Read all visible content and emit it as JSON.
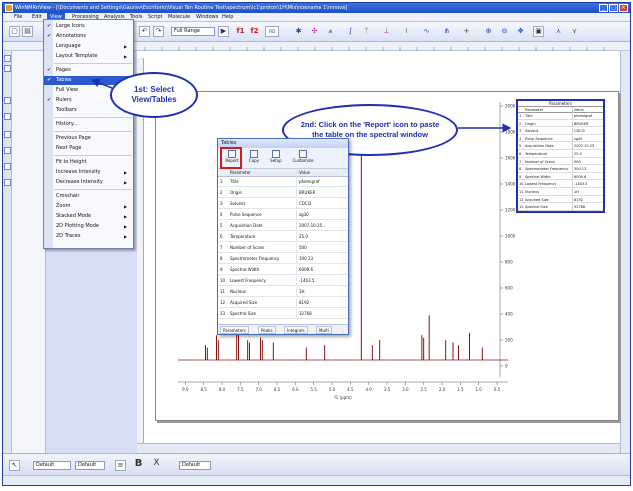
{
  "window": {
    "title": "WinNMRnView - [\\Documents and Settings\\Gaurav\\Escritorio\\Visual Ten Routine Test\\spectrum\\lc1\\proton\\1H\\Mix\\noename 1\\mnova]",
    "controls": [
      "_",
      "□",
      "×"
    ]
  },
  "menubar": {
    "items": [
      "File",
      "Edit",
      "View",
      "Processing",
      "Analysis",
      "Tools",
      "Script",
      "Molecule",
      "Windows",
      "Help"
    ],
    "active_index": 2
  },
  "toolbar": {
    "zoom_value": "Full Range",
    "label_fid": "FID",
    "label_f1": "f1",
    "label_f2": "f2"
  },
  "view_menu": {
    "items": [
      {
        "label": "Large Icons",
        "check": true
      },
      {
        "label": "Annotations",
        "check": true
      },
      {
        "label": "Language",
        "arrow": true
      },
      {
        "label": "Layout Template",
        "arrow": true
      },
      {
        "label": "Pages",
        "check": true
      },
      {
        "label": "Tables",
        "check": true,
        "highlight": true
      },
      {
        "label": "Full View"
      },
      {
        "label": "Rulers",
        "check": true
      },
      {
        "label": "Toolbars",
        "arrow": true
      },
      {
        "label": "History..."
      },
      {
        "label": "Previous Page"
      },
      {
        "label": "Next Page"
      },
      {
        "label": "Fit to Height"
      },
      {
        "label": "Increase Intensity",
        "arrow": true
      },
      {
        "label": "Decrease Intensity",
        "arrow": true
      },
      {
        "label": "Crosshair"
      },
      {
        "label": "Zoom",
        "arrow": true
      },
      {
        "label": "Stacked Mode",
        "arrow": true
      },
      {
        "label": "2D Plotting Mode",
        "arrow": true
      },
      {
        "label": "2D Traces",
        "arrow": true
      }
    ]
  },
  "callouts": {
    "first": "1st: Select View/Tables",
    "second": "2nd: Click on the 'Report' icon to paste the table on the spectral window"
  },
  "tables_window": {
    "title": "Tables",
    "tools": [
      "Report",
      "Copy",
      "Setup",
      "Customize"
    ],
    "header": {
      "param": "Parameter",
      "value": "Value"
    },
    "rows": [
      {
        "n": "1",
        "param": "Title",
        "value": "pfolmigraf"
      },
      {
        "n": "2",
        "param": "Origin",
        "value": "BRUKER"
      },
      {
        "n": "3",
        "param": "Solvent",
        "value": "CDCl3"
      },
      {
        "n": "4",
        "param": "Pulse Sequence",
        "value": "zg30"
      },
      {
        "n": "5",
        "param": "Acquisition Date",
        "value": "2007-10-25..."
      },
      {
        "n": "6",
        "param": "Temperature",
        "value": "25.0"
      },
      {
        "n": "7",
        "param": "Number of Scans",
        "value": "500"
      },
      {
        "n": "8",
        "param": "Spectrometer Frequency",
        "value": "300.13"
      },
      {
        "n": "9",
        "param": "Spectral Width",
        "value": "6009.6"
      },
      {
        "n": "10",
        "param": "Lowest Frequency",
        "value": "-1403.5"
      },
      {
        "n": "11",
        "param": "Nucleus",
        "value": "1H"
      },
      {
        "n": "12",
        "param": "Acquired Size",
        "value": "8192"
      },
      {
        "n": "13",
        "param": "Spectral Size",
        "value": "32768"
      }
    ],
    "tabs": [
      "Parameters",
      "Peaks",
      "Integrals",
      "Multi"
    ]
  },
  "pasted_table": {
    "title": "Parameters",
    "col_param": "Parameter",
    "col_value": "Value",
    "rows": [
      {
        "n": "1",
        "param": "Title",
        "value": "pfolmigraf"
      },
      {
        "n": "2",
        "param": "Origin",
        "value": "BRUKER"
      },
      {
        "n": "3",
        "param": "Solvent",
        "value": "CDCl3"
      },
      {
        "n": "4",
        "param": "Pulse Sequence",
        "value": "zg30"
      },
      {
        "n": "5",
        "param": "Acquisition Date",
        "value": "2007-10-25"
      },
      {
        "n": "6",
        "param": "Temperature",
        "value": "25.0"
      },
      {
        "n": "7",
        "param": "Number of Scans",
        "value": "500"
      },
      {
        "n": "8",
        "param": "Spectrometer Frequency",
        "value": "300.13"
      },
      {
        "n": "9",
        "param": "Spectral Width",
        "value": "6009.6"
      },
      {
        "n": "10",
        "param": "Lowest Frequency",
        "value": "-1403.5"
      },
      {
        "n": "11",
        "param": "Nucleus",
        "value": "1H"
      },
      {
        "n": "12",
        "param": "Acquired Size",
        "value": "8192"
      },
      {
        "n": "13",
        "param": "Spectral Size",
        "value": "32768"
      }
    ]
  },
  "spectrum": {
    "xlabel": "f1 (ppm)",
    "x_ticks": [
      "9.0",
      "8.5",
      "8.0",
      "7.5",
      "7.0",
      "6.5",
      "6.0",
      "5.5",
      "5.0",
      "4.5",
      "4.0",
      "3.5",
      "3.0",
      "2.5",
      "2.0",
      "1.5",
      "1.0",
      "0.5"
    ],
    "y_ticks": [
      "2000",
      "1800",
      "1600",
      "1400",
      "1200",
      "1000",
      "800",
      "600",
      "400",
      "200",
      "0"
    ],
    "line_color": "#8b1010",
    "peaks": [
      {
        "ppm": 8.45,
        "h": 0.06
      },
      {
        "ppm": 8.4,
        "h": 0.05
      },
      {
        "ppm": 8.15,
        "h": 0.1
      },
      {
        "ppm": 8.1,
        "h": 0.08
      },
      {
        "ppm": 7.6,
        "h": 0.11
      },
      {
        "ppm": 7.55,
        "h": 0.1
      },
      {
        "ppm": 7.3,
        "h": 0.08
      },
      {
        "ppm": 7.25,
        "h": 0.07
      },
      {
        "ppm": 6.95,
        "h": 0.09
      },
      {
        "ppm": 6.9,
        "h": 0.08
      },
      {
        "ppm": 6.6,
        "h": 0.07
      },
      {
        "ppm": 5.7,
        "h": 0.05
      },
      {
        "ppm": 5.2,
        "h": 0.06
      },
      {
        "ppm": 4.2,
        "h": 0.9
      },
      {
        "ppm": 3.9,
        "h": 0.06
      },
      {
        "ppm": 3.7,
        "h": 0.08
      },
      {
        "ppm": 2.55,
        "h": 0.1
      },
      {
        "ppm": 2.5,
        "h": 0.09
      },
      {
        "ppm": 2.35,
        "h": 0.18
      },
      {
        "ppm": 1.9,
        "h": 0.08
      },
      {
        "ppm": 1.7,
        "h": 0.07
      },
      {
        "ppm": 1.55,
        "h": 0.06
      },
      {
        "ppm": 1.25,
        "h": 0.11
      },
      {
        "ppm": 0.9,
        "h": 0.05
      }
    ]
  },
  "bottombar": {
    "font_selector": "Default",
    "size_selector": "Default"
  }
}
